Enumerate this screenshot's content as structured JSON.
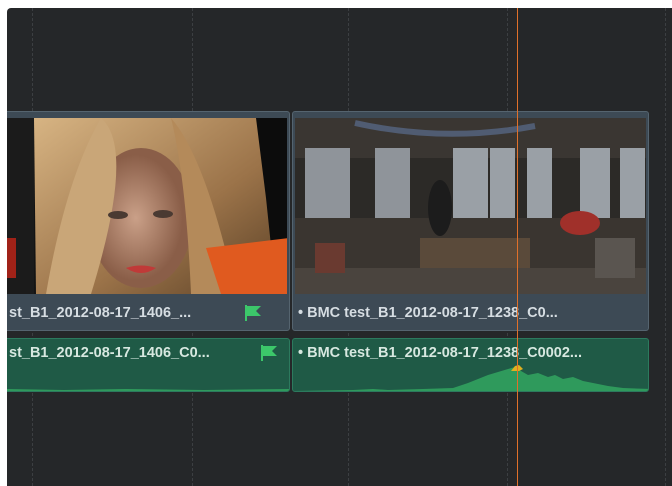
{
  "timeline": {
    "video_track": {
      "clips": [
        {
          "label": "st_B1_2012-08-17_1406_..."
        },
        {
          "label": "• BMC test_B1_2012-08-17_1238_C0..."
        }
      ]
    },
    "audio_track": {
      "clips": [
        {
          "label": "st_B1_2012-08-17_1406_C0..."
        },
        {
          "label": "• BMC test_B1_2012-08-17_1238_C0002..."
        }
      ]
    }
  },
  "colors": {
    "panel_bg": "#252729",
    "video_clip": "#3d4a55",
    "audio_clip": "#1f5a46",
    "playhead": "#e0702a",
    "flag": "#3cc76a"
  },
  "icons": [
    "flag-icon",
    "flag-icon"
  ]
}
